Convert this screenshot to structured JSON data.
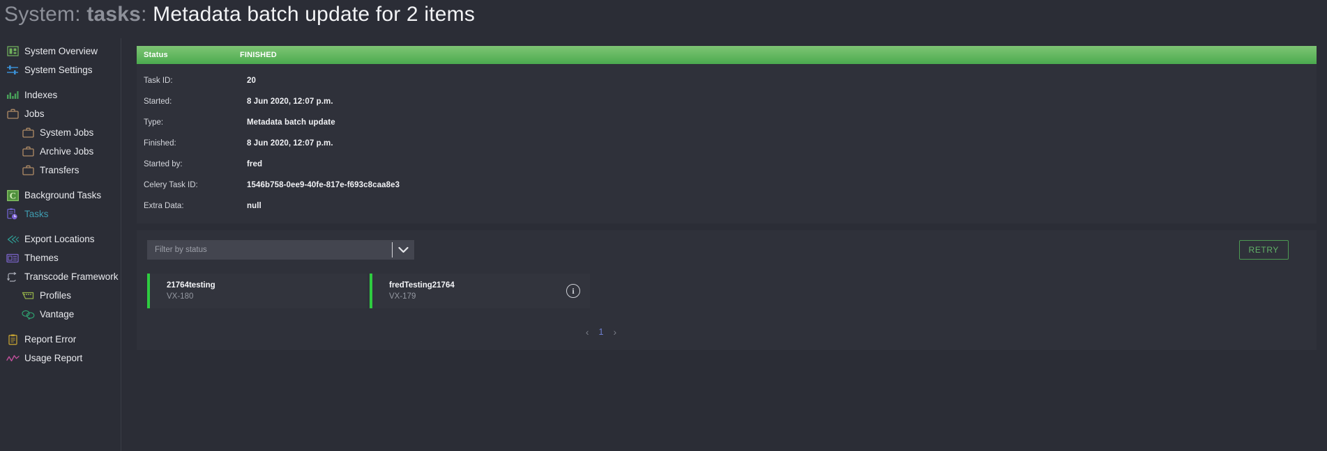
{
  "title": {
    "crumb1": "System",
    "crumb2": "tasks",
    "sep": ":",
    "leaf": "Metadata batch update for 2 items"
  },
  "sidebar": {
    "items": [
      {
        "label": "System Overview",
        "icon": "dashboard-icon",
        "level": 1,
        "active": false
      },
      {
        "label": "System Settings",
        "icon": "sliders-icon",
        "level": 1,
        "active": false
      },
      {
        "label": "Indexes",
        "icon": "bar-chart-icon",
        "level": 1,
        "active": false
      },
      {
        "label": "Jobs",
        "icon": "briefcase-icon",
        "level": 1,
        "active": false
      },
      {
        "label": "System Jobs",
        "icon": "briefcase-icon",
        "level": 2,
        "active": false
      },
      {
        "label": "Archive Jobs",
        "icon": "briefcase-icon",
        "level": 2,
        "active": false
      },
      {
        "label": "Transfers",
        "icon": "briefcase-icon",
        "level": 2,
        "active": false
      },
      {
        "label": "Background Tasks",
        "icon": "celery-c-icon",
        "level": 1,
        "active": false
      },
      {
        "label": "Tasks",
        "icon": "clipboard-clock-icon",
        "level": 1,
        "active": true
      },
      {
        "label": "Export Locations",
        "icon": "double-arrow-left-icon",
        "level": 1,
        "active": false
      },
      {
        "label": "Themes",
        "icon": "newspaper-icon",
        "level": 1,
        "active": false
      },
      {
        "label": "Transcode Framework",
        "icon": "loop-arrow-icon",
        "level": 1,
        "active": false
      },
      {
        "label": "Profiles",
        "icon": "film-strip-icon",
        "level": 2,
        "active": false
      },
      {
        "label": "Vantage",
        "icon": "speech-bubbles-icon",
        "level": 2,
        "active": false
      },
      {
        "label": "Report Error",
        "icon": "clipboard-icon",
        "level": 1,
        "active": false
      },
      {
        "label": "Usage Report",
        "icon": "line-chart-icon",
        "level": 1,
        "active": false
      }
    ]
  },
  "task": {
    "status_label": "Status",
    "status_value": "FINISHED",
    "status_color": "#4bab4f",
    "rows": [
      {
        "key": "Task ID:",
        "value": "20"
      },
      {
        "key": "Started:",
        "value": "8 Jun 2020, 12:07 p.m."
      },
      {
        "key": "Type:",
        "value": "Metadata batch update"
      },
      {
        "key": "Finished:",
        "value": "8 Jun 2020, 12:07 p.m."
      },
      {
        "key": "Started by:",
        "value": "fred"
      },
      {
        "key": "Celery Task ID:",
        "value": "1546b758-0ee9-40fe-817e-f693c8caa8e3"
      },
      {
        "key": "Extra Data:",
        "value": "null"
      }
    ]
  },
  "toolbar": {
    "filter_placeholder": "Filter by status",
    "filter_value": "",
    "retry_label": "RETRY",
    "retry_color": "#62b267"
  },
  "items": [
    {
      "name": "21764testing",
      "id": "VX-180",
      "accent": "#2ecc40",
      "has_info": false,
      "info_glyph": ""
    },
    {
      "name": "fredTesting21764",
      "id": "VX-179",
      "accent": "#2ecc40",
      "has_info": true,
      "info_glyph": "i"
    }
  ],
  "pagination": {
    "prev": "‹",
    "current": "1",
    "next": "›"
  }
}
